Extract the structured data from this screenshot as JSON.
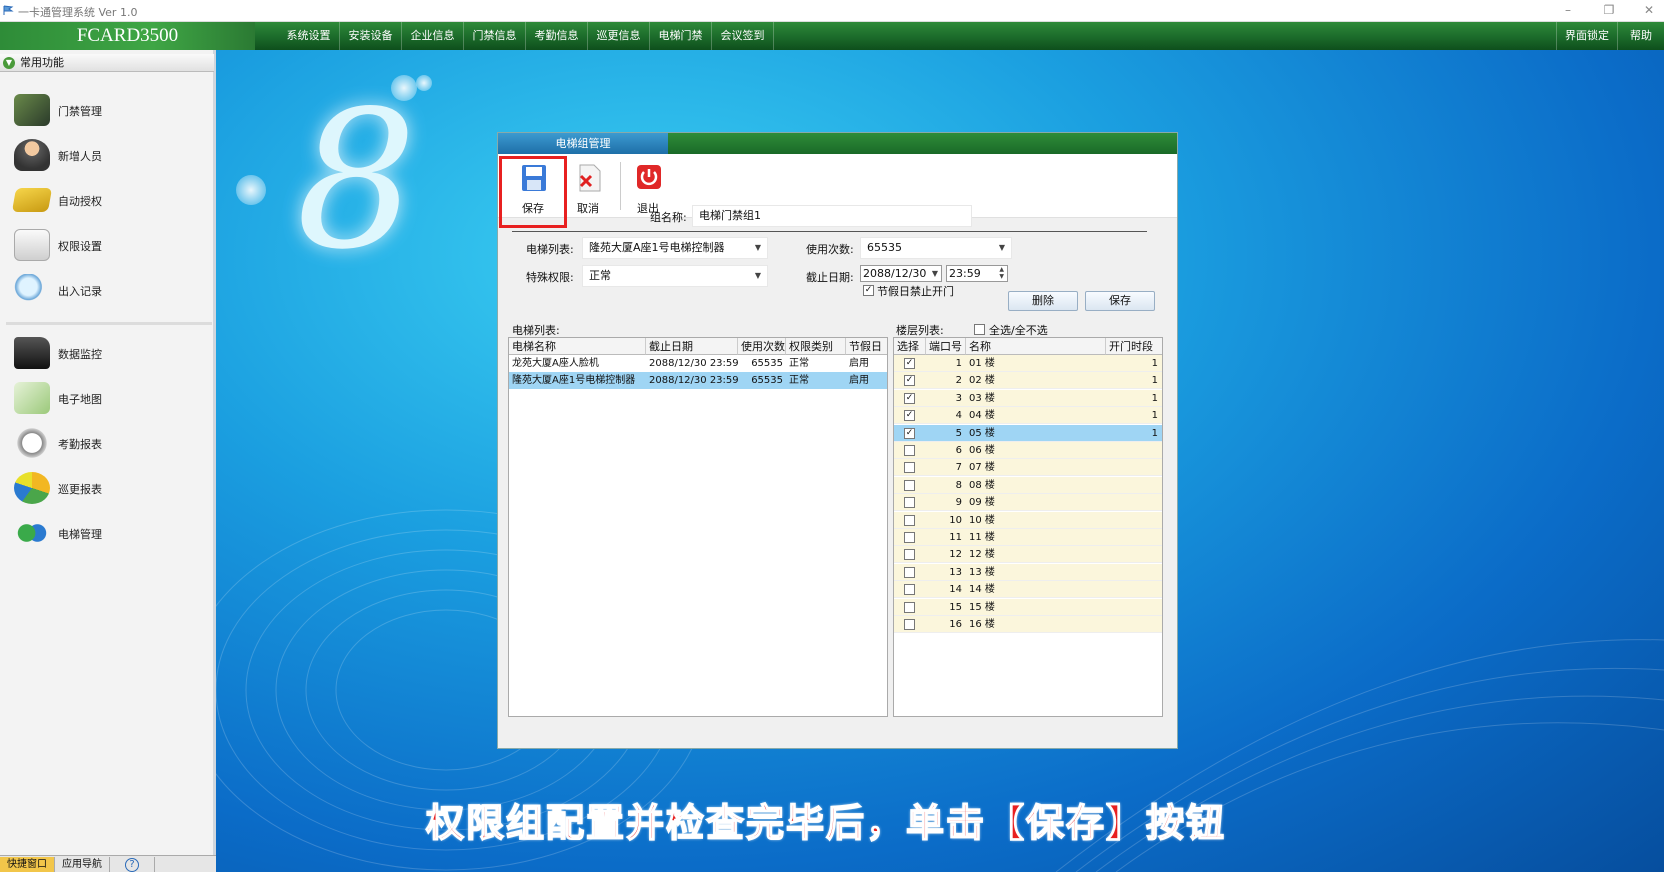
{
  "titlebar": {
    "title": "一卡通管理系统 Ver 1.0"
  },
  "menubar": {
    "brand": "FCARD3500",
    "items": [
      "系统设置",
      "安装设备",
      "企业信息",
      "门禁信息",
      "考勤信息",
      "巡更信息",
      "电梯门禁",
      "会议签到"
    ],
    "right_items": [
      "界面锁定",
      "帮助"
    ]
  },
  "sidebar": {
    "header": "常用功能",
    "items": [
      "门禁管理",
      "新增人员",
      "自动授权",
      "权限设置",
      "出入记录",
      "数据监控",
      "电子地图",
      "考勤报表",
      "巡更报表",
      "电梯管理"
    ]
  },
  "bottom_tabs": [
    "快捷窗口",
    "应用导航",
    "?"
  ],
  "window": {
    "tab_title": "电梯组管理",
    "toolbar": {
      "save": "保存",
      "cancel": "取消",
      "exit": "退出"
    },
    "group_name_label": "组名称:",
    "group_name_value": "电梯门禁组1",
    "elevator_list_label": "电梯列表:",
    "elevator_list_value": "隆苑大厦A座1号电梯控制器",
    "special_perm_label": "特殊权限:",
    "special_perm_value": "正常",
    "use_count_label": "使用次数:",
    "use_count_value": "65535",
    "expiry_label": "截止日期:",
    "expiry_date": "2088/12/30",
    "expiry_time": "23:59",
    "holiday_check_label": "节假日禁止开门",
    "holiday_checked": true,
    "delete_button": "删除",
    "save_button": "保存",
    "elevator_table_label": "电梯列表:",
    "elevator_table": {
      "headers": [
        "电梯名称",
        "截止日期",
        "使用次数",
        "权限类别",
        "节假日"
      ],
      "rows": [
        [
          "龙苑大厦A座人脸机",
          "2088/12/30 23:59",
          "65535",
          "正常",
          "启用"
        ],
        [
          "隆苑大厦A座1号电梯控制器",
          "2088/12/30 23:59",
          "65535",
          "正常",
          "启用"
        ]
      ]
    },
    "floor_table_label": "楼层列表:",
    "select_all_label": "全选/全不选",
    "floor_table": {
      "headers": [
        "选择",
        "端口号",
        "名称",
        "开门时段"
      ],
      "rows": [
        {
          "checked": true,
          "port": "1",
          "name": "01 楼",
          "slot": "1"
        },
        {
          "checked": true,
          "port": "2",
          "name": "02 楼",
          "slot": "1"
        },
        {
          "checked": true,
          "port": "3",
          "name": "03 楼",
          "slot": "1"
        },
        {
          "checked": true,
          "port": "4",
          "name": "04 楼",
          "slot": "1"
        },
        {
          "checked": true,
          "port": "5",
          "name": "05 楼",
          "slot": "1"
        },
        {
          "checked": false,
          "port": "6",
          "name": "06 楼",
          "slot": ""
        },
        {
          "checked": false,
          "port": "7",
          "name": "07 楼",
          "slot": ""
        },
        {
          "checked": false,
          "port": "8",
          "name": "08 楼",
          "slot": ""
        },
        {
          "checked": false,
          "port": "9",
          "name": "09 楼",
          "slot": ""
        },
        {
          "checked": false,
          "port": "10",
          "name": "10 楼",
          "slot": ""
        },
        {
          "checked": false,
          "port": "11",
          "name": "11 楼",
          "slot": ""
        },
        {
          "checked": false,
          "port": "12",
          "name": "12 楼",
          "slot": ""
        },
        {
          "checked": false,
          "port": "13",
          "name": "13 楼",
          "slot": ""
        },
        {
          "checked": false,
          "port": "14",
          "name": "14 楼",
          "slot": ""
        },
        {
          "checked": false,
          "port": "15",
          "name": "15 楼",
          "slot": ""
        },
        {
          "checked": false,
          "port": "16",
          "name": "16 楼",
          "slot": ""
        }
      ]
    }
  },
  "desktop": {
    "logo_char": "8"
  },
  "subtitle": "权限组配置并检查完毕后，单击【保存】按钮",
  "colors": {
    "accent_green": "#1b6a2a",
    "selected_row": "#9fd5f4",
    "highlight_red": "#e82020",
    "floor_row_bg": "#fbf6dc"
  }
}
